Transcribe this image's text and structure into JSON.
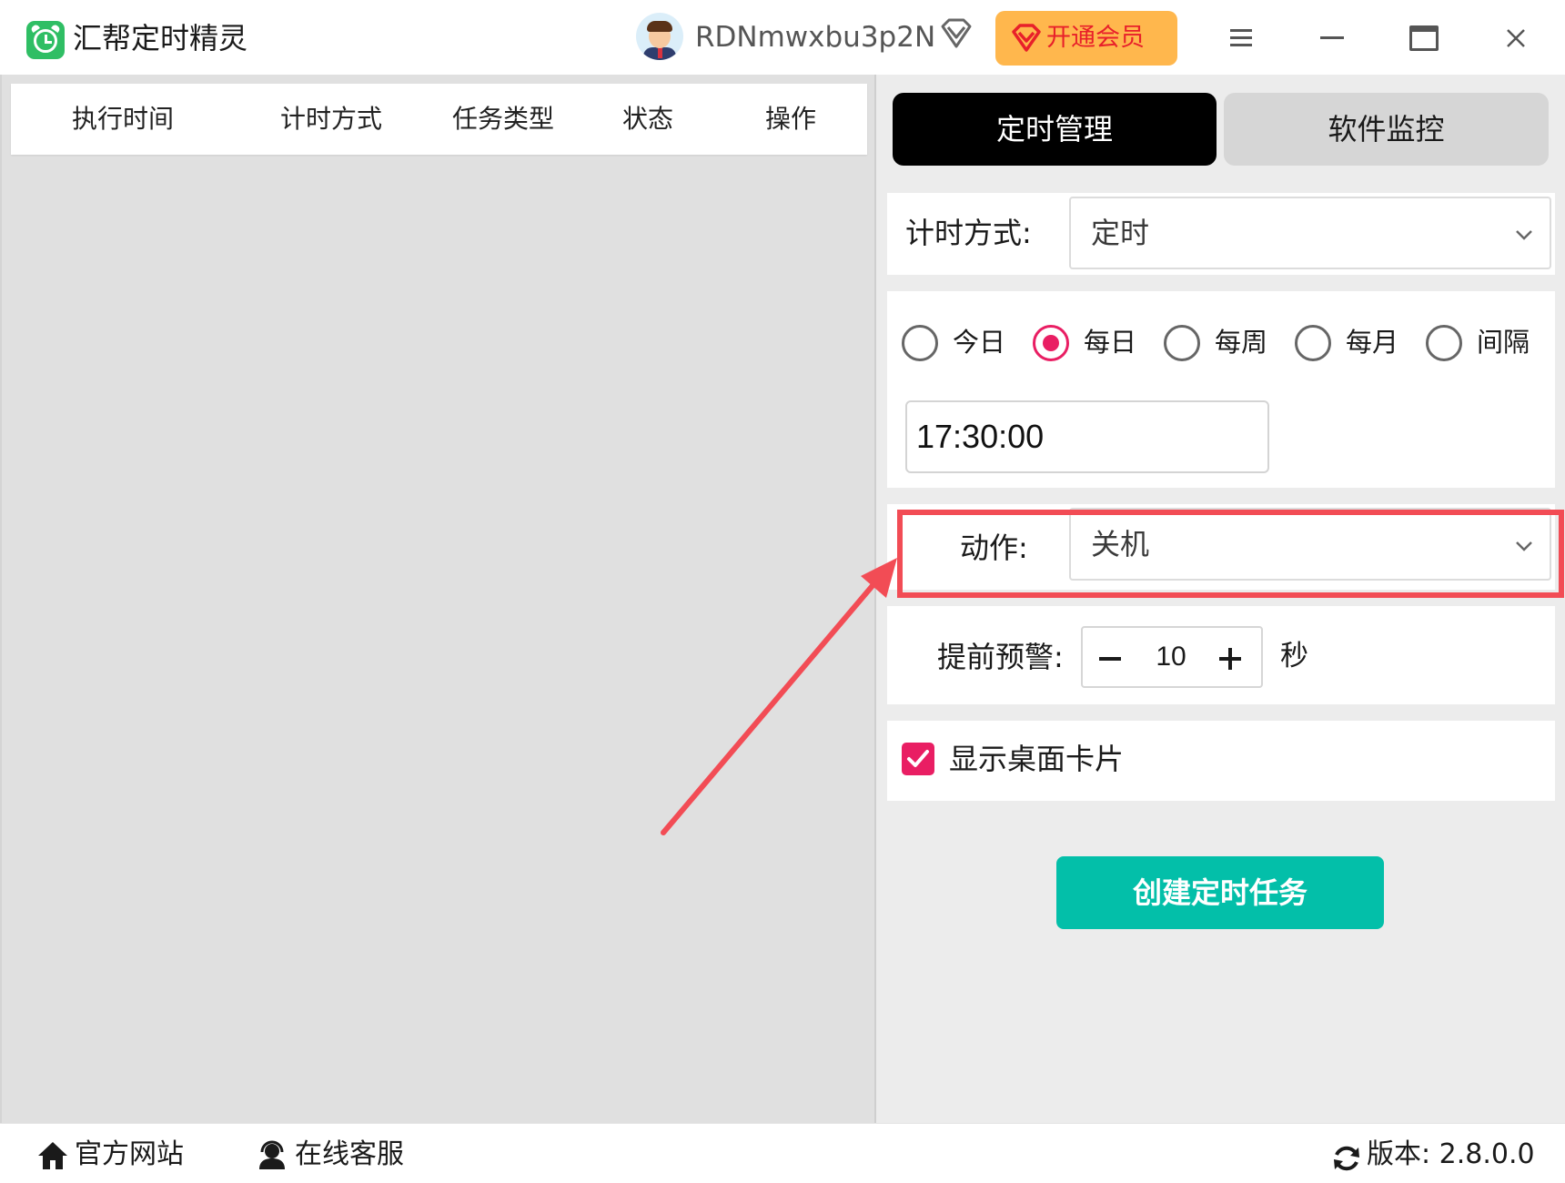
{
  "app": {
    "title": "汇帮定时精灵",
    "username": "RDNmwxbu3p2N",
    "vip_label": "开通会员"
  },
  "task_table": {
    "columns": [
      "执行时间",
      "计时方式",
      "任务类型",
      "状态",
      "操作"
    ]
  },
  "tabs": {
    "schedule": "定时管理",
    "monitor": "软件监控"
  },
  "form": {
    "timing_mode_label": "计时方式:",
    "timing_mode_value": "定时",
    "frequency_options": [
      "今日",
      "每日",
      "每周",
      "每月",
      "间隔"
    ],
    "frequency_selected": "每日",
    "time_value": "17:30:00",
    "action_label": "动作:",
    "action_value": "关机",
    "warning_label": "提前预警:",
    "warning_value": "10",
    "warning_unit": "秒",
    "show_card_label": "显示桌面卡片",
    "show_card_checked": true,
    "create_button": "创建定时任务"
  },
  "footer": {
    "website": "官方网站",
    "support": "在线客服",
    "version": "版本: 2.8.0.0"
  },
  "colors": {
    "accent_pink": "#e91e63",
    "primary_teal": "#03bfa9",
    "vip_orange": "#ffb74d",
    "highlight_red": "#f24c55"
  }
}
